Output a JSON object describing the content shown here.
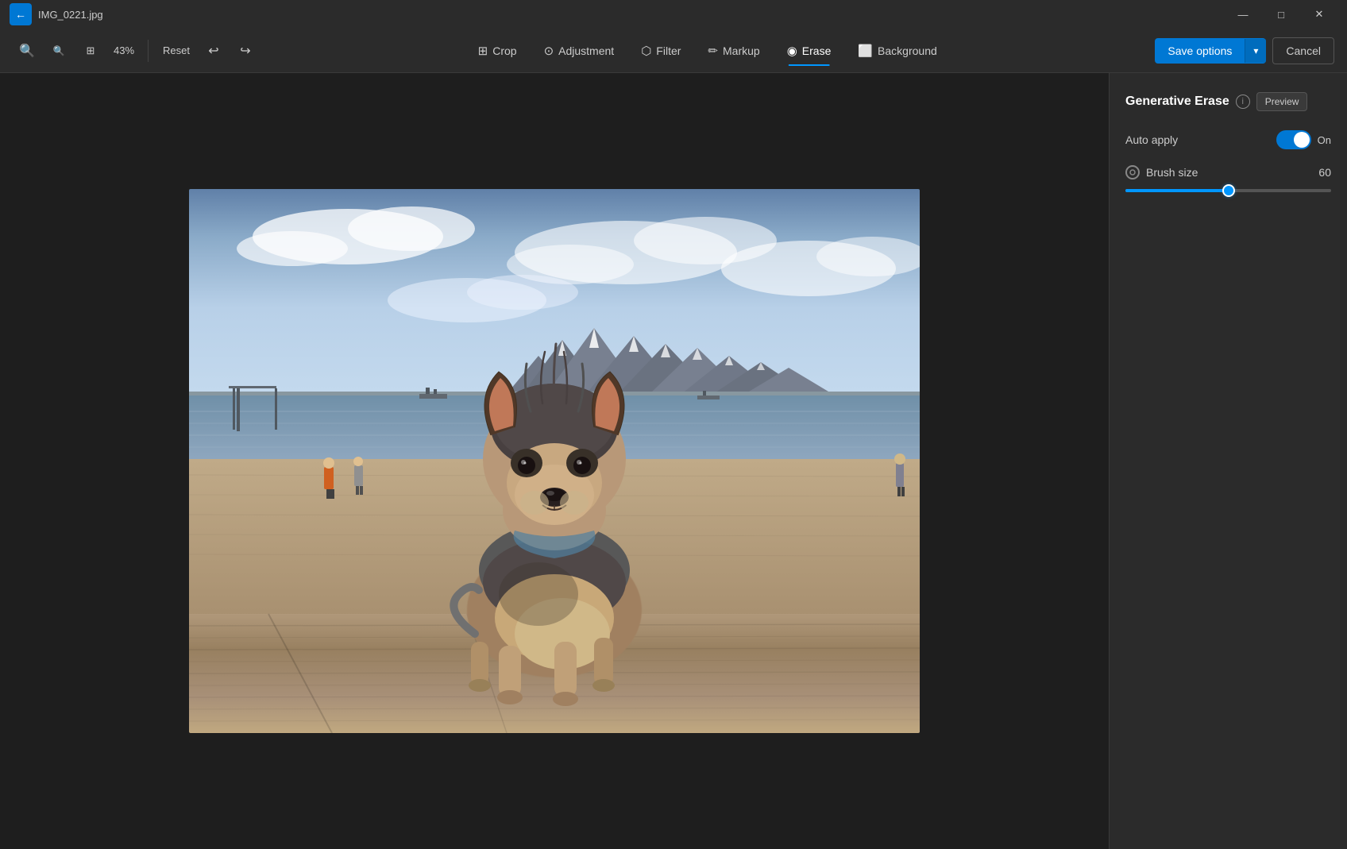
{
  "titlebar": {
    "filename": "IMG_0221.jpg",
    "back_label": "←",
    "minimize_label": "—",
    "maximize_label": "□",
    "close_label": "✕"
  },
  "toolbar": {
    "zoom_level": "43%",
    "reset_label": "Reset",
    "undo_icon": "↩",
    "redo_icon": "↪",
    "tools": [
      {
        "id": "crop",
        "label": "Crop",
        "icon": "✂"
      },
      {
        "id": "adjustment",
        "label": "Adjustment",
        "icon": "◈"
      },
      {
        "id": "filter",
        "label": "Filter",
        "icon": "⬡"
      },
      {
        "id": "markup",
        "label": "Markup",
        "icon": "✏"
      },
      {
        "id": "erase",
        "label": "Erase",
        "icon": "◉"
      },
      {
        "id": "background",
        "label": "Background",
        "icon": "⬜"
      }
    ],
    "active_tool": "erase",
    "save_options_label": "Save options",
    "cancel_label": "Cancel"
  },
  "right_panel": {
    "title": "Generative Erase",
    "preview_label": "Preview",
    "auto_apply_label": "Auto apply",
    "auto_apply_state": "On",
    "brush_size_label": "Brush size",
    "brush_size_value": "60",
    "slider_fill_percent": 50
  }
}
